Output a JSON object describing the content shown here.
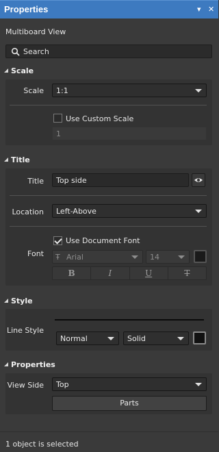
{
  "window": {
    "title": "Properties",
    "pin_icon": "dropdown-arrow-icon",
    "close_icon": "close-icon"
  },
  "panel": {
    "subtitle": "Multiboard View"
  },
  "search": {
    "placeholder": "Search"
  },
  "sections": {
    "scale": {
      "header": "Scale",
      "scale_label": "Scale",
      "scale_value": "1:1",
      "custom_scale_label": "Use Custom Scale",
      "custom_scale_checked": false,
      "custom_scale_value": "1"
    },
    "title": {
      "header": "Title",
      "title_label": "Title",
      "title_value": "Top side",
      "location_label": "Location",
      "location_value": "Left-Above",
      "font_label": "Font",
      "use_document_font_label": "Use Document Font",
      "use_document_font_checked": true,
      "font_family": "Arial",
      "font_size": "14",
      "format_buttons": [
        "B",
        "I",
        "U",
        "T"
      ]
    },
    "style": {
      "header": "Style",
      "line_style_label": "Line Style",
      "line_weight": "Normal",
      "line_pattern": "Solid"
    },
    "properties": {
      "header": "Properties",
      "view_side_label": "View Side",
      "view_side_value": "Top",
      "parts_button": "Parts"
    }
  },
  "status": {
    "text": "1 object is selected"
  },
  "colors": {
    "titlebar": "#3d7ac0",
    "panel_bg": "#3a3a3a",
    "group_bg": "#333333"
  }
}
